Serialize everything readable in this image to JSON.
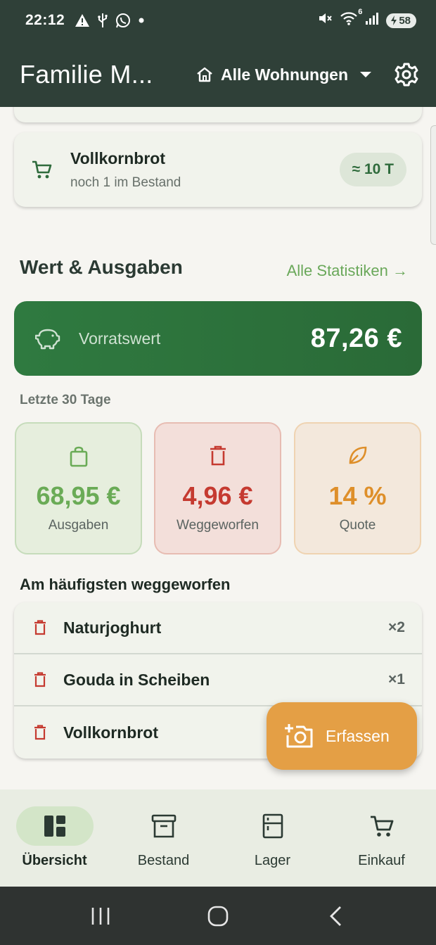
{
  "status_bar": {
    "time": "22:12",
    "battery": "58",
    "left_icons": [
      "alert-icon",
      "usb-icon",
      "whatsapp-icon",
      "dot-icon"
    ],
    "right_icons": [
      "mute-icon",
      "wifi-icon",
      "signal-icon",
      "battery-icon"
    ],
    "wifi_badge": "6"
  },
  "app_bar": {
    "title": "Familie M...",
    "home_select": "Alle Wohnungen",
    "icons": [
      "home-icon",
      "dropdown-arrow-icon",
      "settings-icon"
    ]
  },
  "item_card": {
    "name": "Vollkornbrot",
    "sub": "noch 1 im Bestand",
    "badge": "≈ 10 T",
    "icon": "cart-icon"
  },
  "stats_section": {
    "title": "Wert & Ausgaben",
    "link": "Alle Statistiken →"
  },
  "value_card": {
    "label": "Vorratswert",
    "amount": "87,26 €",
    "icon": "piggy-bank-icon"
  },
  "period": "Letzte 30 Tage",
  "stat_tiles": [
    {
      "value": "68,95 €",
      "label": "Ausgaben",
      "icon": "shopping-bag-icon",
      "color": "#6aab56"
    },
    {
      "value": "4,96 €",
      "label": "Weggeworfen",
      "icon": "trash-icon",
      "color": "#c53a30"
    },
    {
      "value": "14 %",
      "label": "Quote",
      "icon": "leaf-icon",
      "color": "#de8f2a"
    }
  ],
  "wasted": {
    "title": "Am häufigsten weggeworfen",
    "items": [
      {
        "name": "Naturjoghurt",
        "count": "×2"
      },
      {
        "name": "Gouda in Scheiben",
        "count": "×1"
      },
      {
        "name": "Vollkornbrot",
        "count": ""
      }
    ]
  },
  "fab": {
    "label": "Erfassen",
    "icon": "add-photo-icon"
  },
  "bottom_nav": [
    {
      "label": "Übersicht",
      "icon": "dashboard-icon",
      "active": true
    },
    {
      "label": "Bestand",
      "icon": "archive-icon",
      "active": false
    },
    {
      "label": "Lager",
      "icon": "fridge-icon",
      "active": false
    },
    {
      "label": "Einkauf",
      "icon": "cart-icon",
      "active": false
    }
  ],
  "colors": {
    "appbar": "#2f4038",
    "primary_green": "#2f7a40",
    "accent_orange": "#e49f45",
    "danger_red": "#c53a30"
  }
}
